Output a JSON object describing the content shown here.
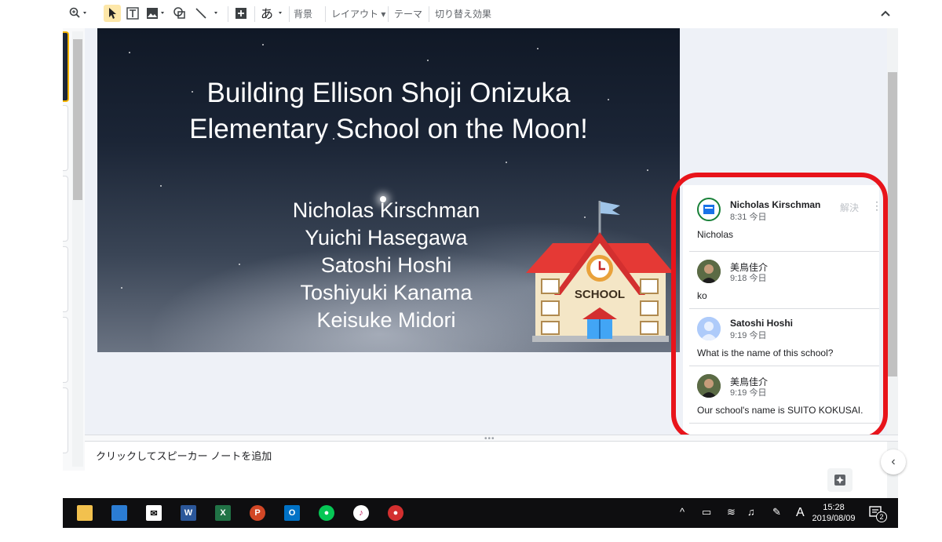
{
  "toolbar": {
    "labels": {
      "background": "背景",
      "layout": "レイアウト",
      "theme": "テーマ",
      "transition": "切り替え効果"
    }
  },
  "slide": {
    "title_lines": [
      "Building Ellison Shoji Onizuka",
      "Elementary School on the Moon!"
    ],
    "authors": [
      "Nicholas Kirschman",
      "Yuichi Hasegawa",
      "Satoshi Hoshi",
      "Toshiyuki Kanama",
      "Keisuke Midori"
    ],
    "school_label": "SCHOOL"
  },
  "speaker_notes": {
    "placeholder": "クリックしてスピーカー ノートを追加"
  },
  "comments": {
    "resolve_label": "解決",
    "items": [
      {
        "author": "Nicholas Kirschman",
        "time": "8:31 今日",
        "text": "Nicholas"
      },
      {
        "author": "美鳥佳介",
        "time": "9:18 今日",
        "text": "ko"
      },
      {
        "author": "Satoshi Hoshi",
        "time": "9:19 今日",
        "text": "What is the name of this school?"
      },
      {
        "author": "美鳥佳介",
        "time": "9:19 今日",
        "text": "Our school's name is SUITO KOKUSAI."
      }
    ],
    "highlight_color": "#e8141b"
  },
  "taskbar": {
    "time": "15:28",
    "date": "2019/08/09",
    "ime_label": "A",
    "notification_count": "2"
  },
  "colors": {
    "accent_yellow": "#fde7a9",
    "taskbar_bg": "#0e0e10"
  }
}
